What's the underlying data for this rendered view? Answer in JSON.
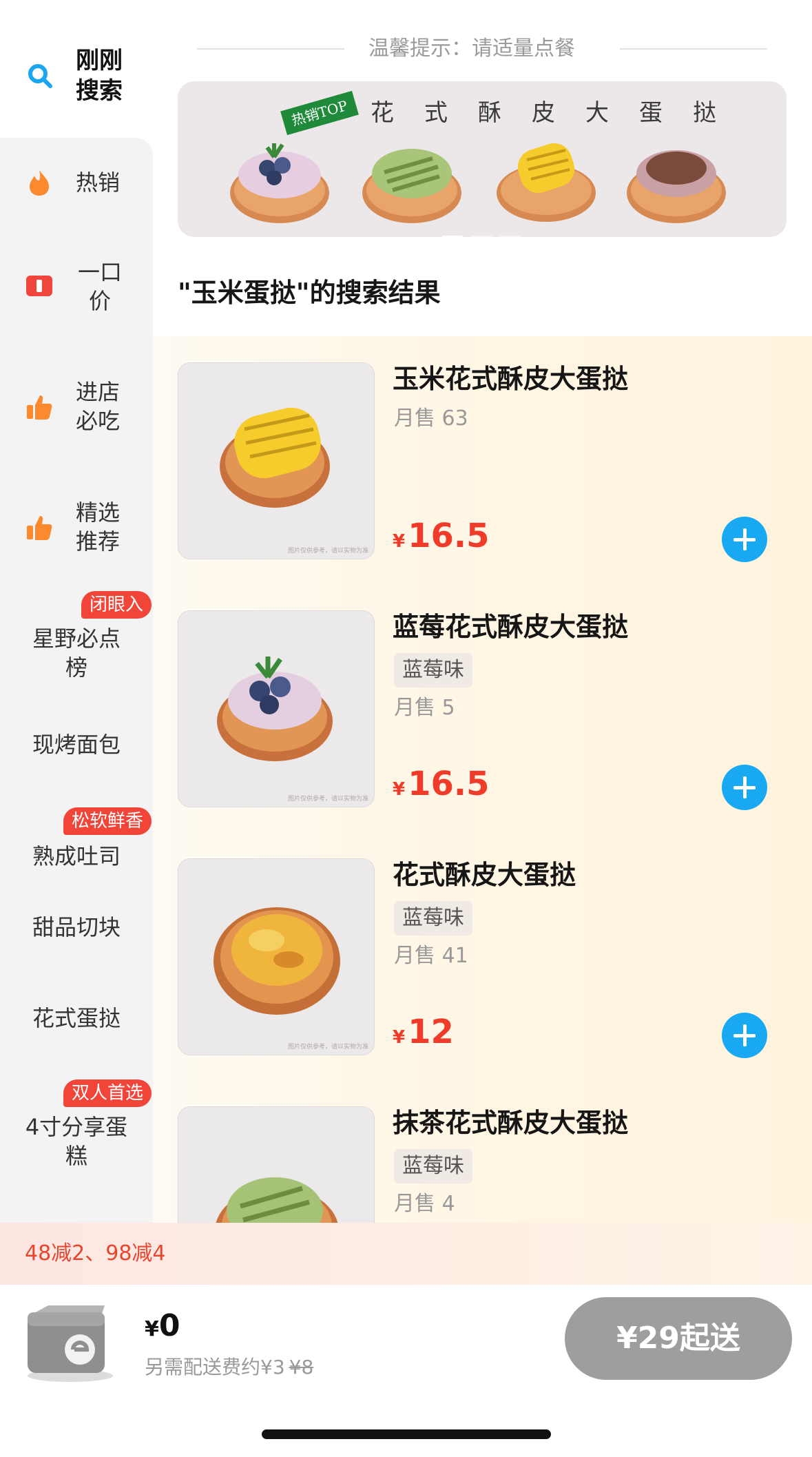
{
  "sidebar": {
    "top_label": "刚刚搜索",
    "items": [
      {
        "label": "热销",
        "icon": "fire-icon"
      },
      {
        "label": "一口价",
        "icon": "price-tag-icon"
      },
      {
        "label": "进店必吃",
        "icon": "thumbs-up-icon"
      },
      {
        "label": "精选推荐",
        "icon": "thumbs-up-icon"
      },
      {
        "label": "星野必点榜",
        "tag": "闭眼入"
      },
      {
        "label": "现烤面包"
      },
      {
        "label": "熟成吐司",
        "tag": "松软鲜香"
      },
      {
        "label": "甜品切块"
      },
      {
        "label": "花式蛋挞"
      },
      {
        "label": "4寸分享蛋糕",
        "tag": "双人首选"
      }
    ]
  },
  "header": {
    "hint": "温馨提示：请适量点餐"
  },
  "banner": {
    "ribbon": "热销TOP",
    "title_chars": [
      "花",
      "式",
      "酥",
      "皮",
      "大",
      "蛋",
      "挞"
    ],
    "active_dot": 1,
    "dot_count": 3
  },
  "results": {
    "title": "\"玉米蛋挞\"的搜索结果"
  },
  "products": [
    {
      "name": "玉米花式酥皮大蛋挞",
      "spec": "",
      "sales": "月售 63",
      "currency": "¥",
      "price": "16.5"
    },
    {
      "name": "蓝莓花式酥皮大蛋挞",
      "spec": "蓝莓味",
      "sales": "月售 5",
      "currency": "¥",
      "price": "16.5"
    },
    {
      "name": "花式酥皮大蛋挞",
      "spec": "蓝莓味",
      "sales": "月售 41",
      "currency": "¥",
      "price": "12"
    },
    {
      "name": "抹茶花式酥皮大蛋挞",
      "spec": "蓝莓味",
      "sales": "月售 4",
      "currency": "¥",
      "price": ""
    }
  ],
  "promo": {
    "text": "48减2、98减4"
  },
  "cart": {
    "currency": "¥",
    "total": "0",
    "fee_text": "另需配送费约¥3",
    "fee_old": "¥8",
    "checkout_label": "¥29起送"
  },
  "colors": {
    "accent_blue": "#18a9f2",
    "price_red": "#ef3b2a",
    "tag_red": "#f04538",
    "checkout_gray": "#9e9e9e"
  }
}
